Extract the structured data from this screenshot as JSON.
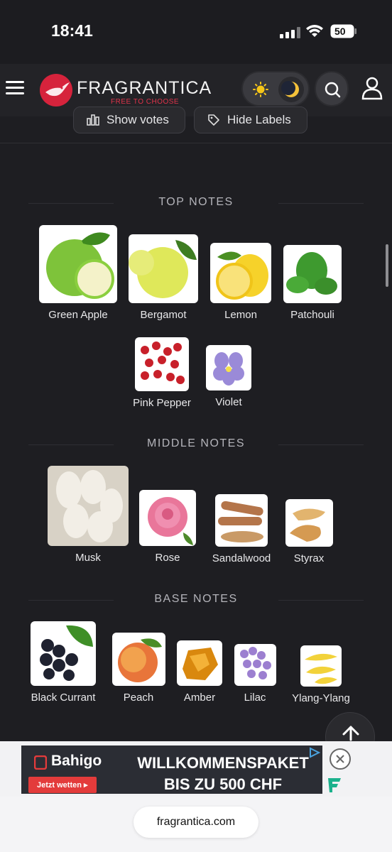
{
  "status_bar": {
    "time": "18:41",
    "battery": "50"
  },
  "header": {
    "logo_text": "FRAGRANTICA",
    "logo_tagline": "FREE TO CHOOSE",
    "icons": [
      "menu-icon",
      "sun-icon",
      "moon-icon",
      "search-icon",
      "user-icon"
    ]
  },
  "toolbar": {
    "show_votes": "Show votes",
    "hide_labels": "Hide Labels"
  },
  "pyramid": {
    "top_title": "TOP NOTES",
    "top_notes": [
      {
        "label": "Green Apple"
      },
      {
        "label": "Bergamot"
      },
      {
        "label": "Lemon"
      },
      {
        "label": "Patchouli"
      },
      {
        "label": "Pink Pepper"
      },
      {
        "label": "Violet"
      }
    ],
    "middle_title": "MIDDLE NOTES",
    "middle_notes": [
      {
        "label": "Musk"
      },
      {
        "label": "Rose"
      },
      {
        "label": "Sandalwood"
      },
      {
        "label": "Styrax"
      }
    ],
    "base_title": "BASE NOTES",
    "base_notes": [
      {
        "label": "Black Currant"
      },
      {
        "label": "Peach"
      },
      {
        "label": "Amber"
      },
      {
        "label": "Lilac"
      },
      {
        "label": "Ylang-Ylang"
      }
    ]
  },
  "ad": {
    "brand": "Bahigo",
    "cta": "Jetzt wetten",
    "headline_line1": "WILLKOMMENSPAKET",
    "headline_line2": "BIS ZU 500 CHF"
  },
  "browser": {
    "url": "fragrantica.com"
  },
  "colors": {
    "accent": "#d6233c",
    "background": "#1e1e22",
    "ad_cta": "#e33b3b"
  }
}
